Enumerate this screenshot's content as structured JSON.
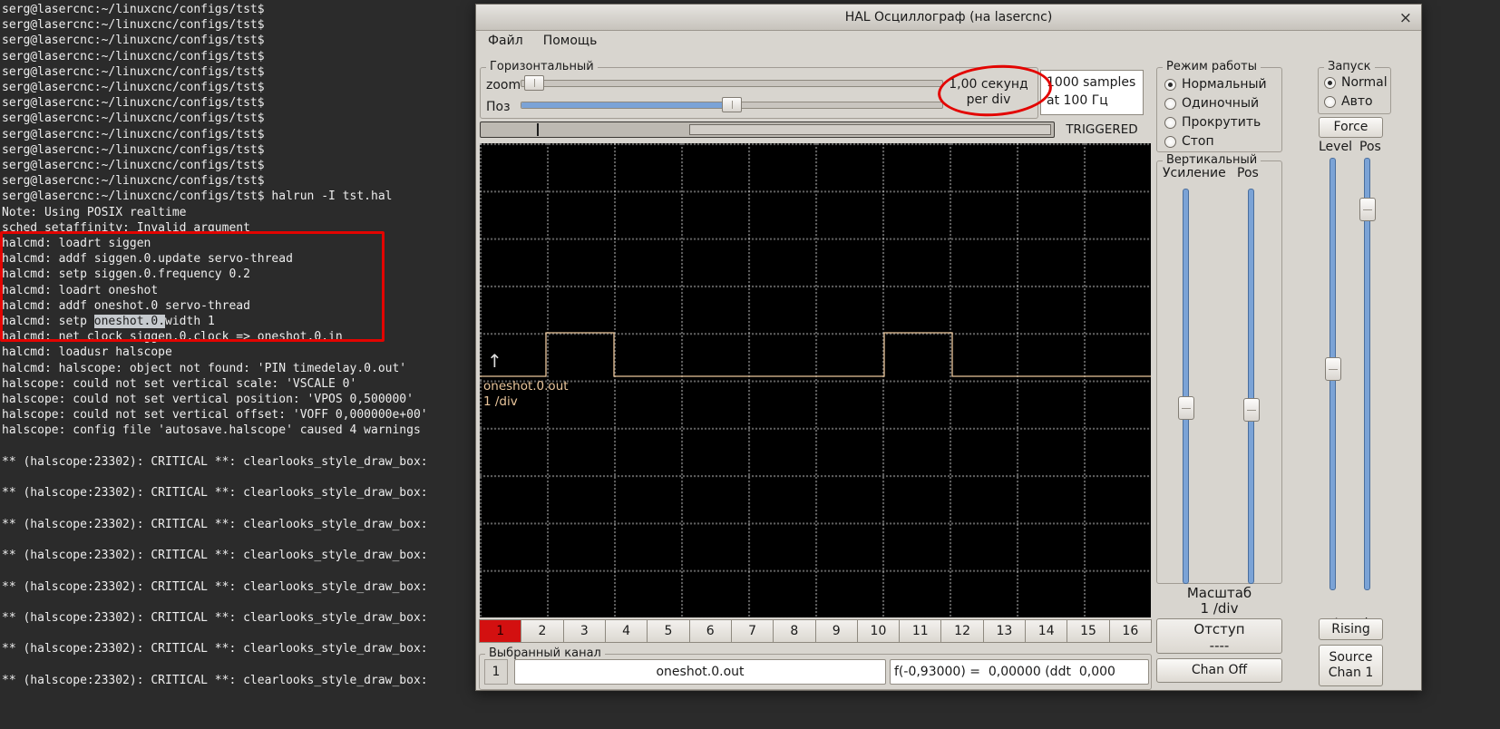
{
  "terminal": {
    "text": "serg@lasercnc:~/linuxcnc/configs/tst$\nserg@lasercnc:~/linuxcnc/configs/tst$\nserg@lasercnc:~/linuxcnc/configs/tst$\nserg@lasercnc:~/linuxcnc/configs/tst$\nserg@lasercnc:~/linuxcnc/configs/tst$\nserg@lasercnc:~/linuxcnc/configs/tst$\nserg@lasercnc:~/linuxcnc/configs/tst$\nserg@lasercnc:~/linuxcnc/configs/tst$\nserg@lasercnc:~/linuxcnc/configs/tst$\nserg@lasercnc:~/linuxcnc/configs/tst$\nserg@lasercnc:~/linuxcnc/configs/tst$\nserg@lasercnc:~/linuxcnc/configs/tst$\nserg@lasercnc:~/linuxcnc/configs/tst$ halrun -I tst.hal\nNote: Using POSIX realtime\nsched setaffinity: Invalid argument\nhalcmd: loadrt siggen\nhalcmd: addf siggen.0.update servo-thread\nhalcmd: setp siggen.0.frequency 0.2\nhalcmd: loadrt oneshot\nhalcmd: addf oneshot.0 servo-thread\nhalcmd: setp oneshot.0.width 1\nhalcmd: net clock siggen.0.clock => oneshot.0.in\nhalcmd: loadusr halscope\nhalcmd: halscope: object not found: 'PIN timedelay.0.out'\nhalscope: could not set vertical scale: 'VSCALE 0'\nhalscope: could not set vertical position: 'VPOS 0,500000'\nhalscope: could not set vertical offset: 'VOFF 0,000000e+00'\nhalscope: config file 'autosave.halscope' caused 4 warnings\n\n** (halscope:23302): CRITICAL **: clearlooks_style_draw_box: \n\n** (halscope:23302): CRITICAL **: clearlooks_style_draw_box: \n\n** (halscope:23302): CRITICAL **: clearlooks_style_draw_box: \n\n** (halscope:23302): CRITICAL **: clearlooks_style_draw_box: \n\n** (halscope:23302): CRITICAL **: clearlooks_style_draw_box: \n\n** (halscope:23302): CRITICAL **: clearlooks_style_draw_box: \n\n** (halscope:23302): CRITICAL **: clearlooks_style_draw_box: \n\n** (halscope:23302): CRITICAL **: clearlooks_style_draw_box: ",
    "selection": {
      "prefix": "halcmd: setp ",
      "text": "oneshot.0."
    }
  },
  "window": {
    "title": "HAL Осциллограф (на lasercnc)",
    "close_label": "×",
    "menu": {
      "file": "Файл",
      "help": "Помощь"
    },
    "horizontal": {
      "group_label": "Горизонтальный",
      "zoom_label": "zoom",
      "pos_label": "Поз",
      "scale_line1": "1,00 секунд",
      "scale_line2": "per div",
      "samples_line1": "1000 samples",
      "samples_line2": "at 100 Гц",
      "trigger_status": "TRIGGERED"
    },
    "scope": {
      "signal_label": "oneshot.0.out",
      "scale_label": "1 /div",
      "trace_color": "#e9c59b",
      "trace_points": "0,257 73,257 73,209 148,209 148,257 446,257 446,209 521,209 521,257 740,257",
      "trigger_arrow": "↑"
    },
    "run_mode": {
      "group_label": "Режим работы",
      "options": [
        {
          "label": "Нормальный",
          "selected": true
        },
        {
          "label": "Одиночный",
          "selected": false
        },
        {
          "label": "Прокрутить",
          "selected": false
        },
        {
          "label": "Стоп",
          "selected": false
        }
      ]
    },
    "vertical": {
      "group_label": "Вертикальный",
      "gain_label": "Усиление",
      "pos_label": "Pos",
      "scale_title": "Масштаб",
      "scale_value": "1 /div",
      "offset_title": "Отступ",
      "offset_value": "----",
      "chan_off_label": "Chan Off"
    },
    "trigger_panel": {
      "group_label": "Запуск",
      "options": [
        {
          "label": "Normal",
          "selected": true
        },
        {
          "label": "Авто",
          "selected": false
        }
      ],
      "force_label": "Force",
      "level_col_label": "Level",
      "pos_col_label": "Pos",
      "level_title": "Level",
      "level_value": "----",
      "rising_label": "Rising",
      "source_line1": "Source",
      "source_line2": "Chan 1"
    },
    "channels": {
      "items": [
        "1",
        "2",
        "3",
        "4",
        "5",
        "6",
        "7",
        "8",
        "9",
        "10",
        "11",
        "12",
        "13",
        "14",
        "15",
        "16"
      ],
      "selected": "1"
    },
    "selected_channel": {
      "group_label": "Выбранный канал",
      "number": "1",
      "name": "oneshot.0.out",
      "readout": "f(-0,93000) =  0,00000 (ddt  0,000"
    }
  }
}
